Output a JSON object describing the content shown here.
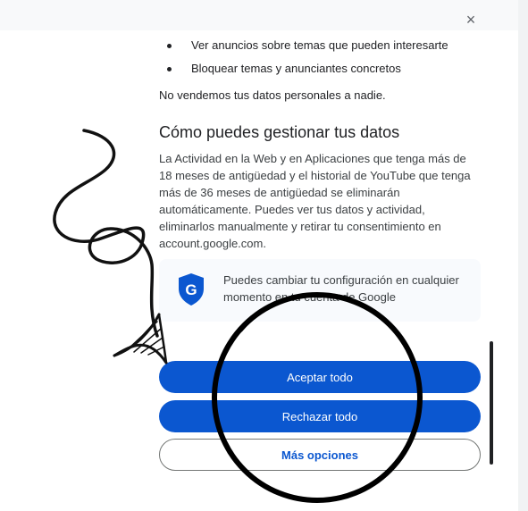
{
  "dialog": {
    "close_label": "×",
    "bullets": [
      "Ver anuncios sobre temas que pueden interesarte",
      "Bloquear temas y anunciantes concretos"
    ],
    "no_sell_text": "No vendemos tus datos personales a nadie.",
    "section_title": "Cómo puedes gestionar tus datos",
    "section_body": "La Actividad en la Web y en Aplicaciones que tenga más de 18 meses de antigüedad y el historial de YouTube que tenga más de 36 meses de antigüedad se eliminarán automáticamente. Puedes ver tus datos y actividad, eliminarlos manualmente y retirar tu consentimiento en account.google.com.",
    "info_card": {
      "icon": "google-shield-icon",
      "icon_letter": "G",
      "text": "Puedes cambiar tu configuración en cualquier momento en tu cuenta de Google"
    },
    "buttons": {
      "accept_all": "Aceptar todo",
      "reject_all": "Rechazar todo",
      "more_options": "Más opciones"
    }
  },
  "colors": {
    "primary": "#0b57d0",
    "text": "#202124",
    "muted_text": "#3c4043",
    "card_bg": "#f8fafd"
  },
  "annotations": {
    "arrow": "hand-drawn-arrow",
    "circle": "hand-drawn-circle"
  }
}
